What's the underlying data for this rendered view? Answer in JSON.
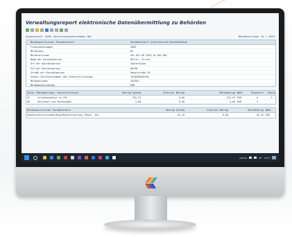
{
  "window": {
    "title": "Verwaltungsreport elektronische Datenübermittlung zu Behörden",
    "company_label": "Organschaft: 819R (Unterorganunternehmen 80)",
    "period_label": "Meldezeitraum: 01 / 2023"
  },
  "main_table": {
    "headers": [
      "",
      "Meldespezifischer Parameterwert",
      "Parameterwert elektronische Datenbehörde"
    ],
    "rows": [
      {
        "key": "Finanzamtsnummer",
        "value": "2003"
      },
      {
        "key": "Meldeland",
        "value": "DE"
      },
      {
        "key": "Meldezeitraum",
        "value": "USt UEJ DE 2023 01 001 001"
      },
      {
        "key": "Name der Kontaktperson",
        "value": "Müller, Ulrich"
      },
      {
        "key": "Ort der Kontaktperson",
        "value": "Saarbrücken"
      },
      {
        "key": "PLZ der Kontaktperson",
        "value": "66130"
      },
      {
        "key": "Straße der Kontaktperson",
        "value": "Hauptstraße 54"
      },
      {
        "key": "Steuer-ID/Steuernummer des Steuerpflichtigen",
        "value": "1010505050100"
      },
      {
        "key": "Meldeperiode",
        "value": "202301"
      },
      {
        "key": "Meldebeschreibung",
        "value": "EUR"
      }
    ]
  },
  "lines_table": {
    "headers": [
      "Zeile ID",
      "Meldebetrags. Kennzifferntext",
      "Betrag System",
      "Externer Betrag",
      "Meldebetrag",
      "Währ.",
      "Steuerart",
      "Basis"
    ],
    "rows": [
      [
        "81",
        "Inlandsumsätze zu 19%",
        "252,23",
        "0,00",
        "252,23",
        "EUR",
        "A",
        "X"
      ],
      [
        "66",
        "Vorsteuer aus Rechnungen",
        "3,60",
        "0,00",
        "3,60",
        "EUR",
        "V",
        ""
      ]
    ]
  },
  "summary_table": {
    "headers": [
      "Meldespezifischer Parameterwert",
      "Betrag System",
      "Externer Betrag",
      "Meldebetrag",
      "Währ."
    ],
    "rows": [
      [
        "Umsatzsteuervoranmeldung/Rückerstattung (Resul. 83)",
        "42,44",
        "0,00",
        "42,44",
        "EUR"
      ]
    ]
  },
  "taskbar": {
    "tray_text": "jakobfa",
    "time": "14:53",
    "date": "DE"
  },
  "colors": {
    "accent": "#3e8ede",
    "taskbar": "#1d2733",
    "header_row": "#d9e6ee"
  },
  "icons": [
    "windows-start-icon",
    "search-icon",
    "logo-icon"
  ]
}
